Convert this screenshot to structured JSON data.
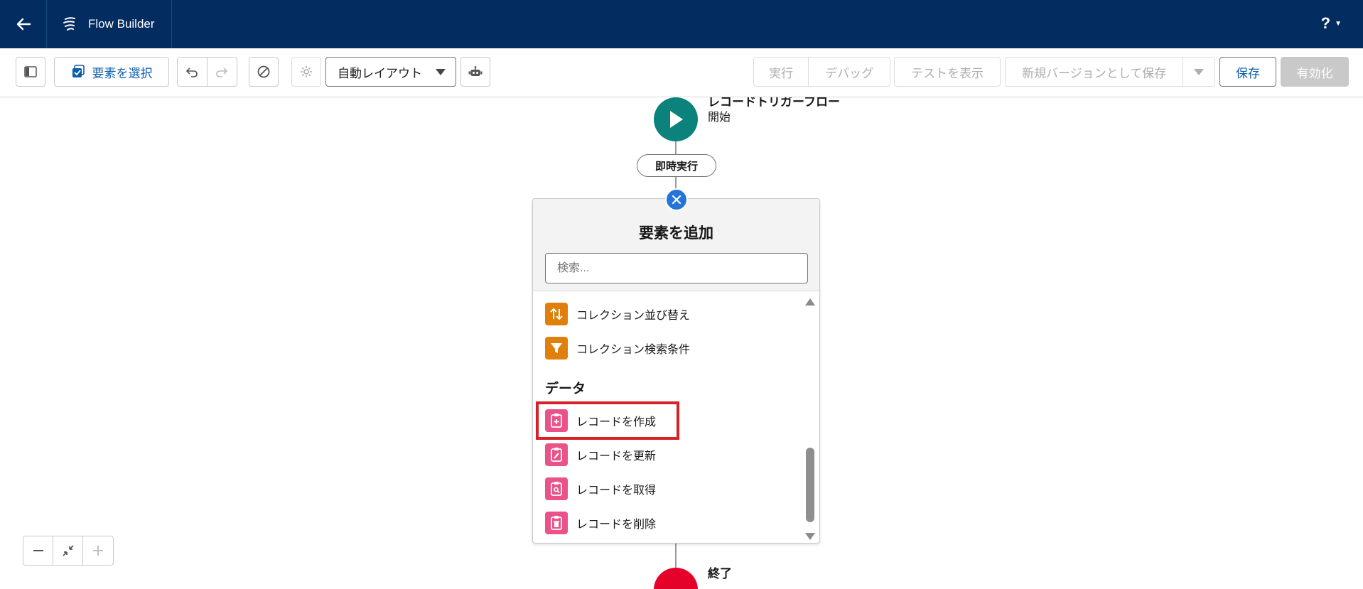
{
  "header": {
    "back_icon": "arrow-left-icon",
    "app_icon": "flow-icon",
    "app_title": "Flow Builder",
    "help_label": "?"
  },
  "toolbar": {
    "toggle_panel_icon": "sidebar-toggle-icon",
    "select_elements_label": "要素を選択",
    "undo_icon": "undo-icon",
    "redo_icon": "redo-icon",
    "clear_icon": "block-icon",
    "settings_icon": "gear-icon",
    "layout_select_value": "自動レイアウト",
    "auto_arrange_icon": "robot-icon",
    "run_label": "実行",
    "debug_label": "デバッグ",
    "show_tests_label": "テストを表示",
    "save_new_version_label": "新規バージョンとして保存",
    "save_label": "保存",
    "activate_label": "有効化"
  },
  "canvas": {
    "start_title": "レコードトリガーフロー",
    "start_subtitle": "開始",
    "path_label": "即時実行",
    "end_label": "終了"
  },
  "add_element_panel": {
    "title": "要素を追加",
    "search_placeholder": "検索...",
    "items_top": [
      {
        "label": "コレクション並び替え",
        "icon": "sort-arrows-icon"
      },
      {
        "label": "コレクション検索条件",
        "icon": "filter-icon"
      }
    ],
    "section_data": "データ",
    "data_items": [
      {
        "label": "レコードを作成",
        "icon": "record-create-icon"
      },
      {
        "label": "レコードを更新",
        "icon": "record-update-icon"
      },
      {
        "label": "レコードを取得",
        "icon": "record-lookup-icon"
      },
      {
        "label": "レコードを削除",
        "icon": "record-delete-icon"
      }
    ]
  },
  "zoom": {
    "zoom_out_icon": "minus-icon",
    "fit_icon": "contract-icon",
    "zoom_in_icon": "plus-icon"
  },
  "colors": {
    "header_bg": "#032d60",
    "brand_blue": "#0b5cab",
    "start_green": "#0b827c",
    "end_red": "#e4022b",
    "orange_icon": "#e07f0b",
    "pink_icon": "#ea5387",
    "highlight_red": "#d72128"
  }
}
